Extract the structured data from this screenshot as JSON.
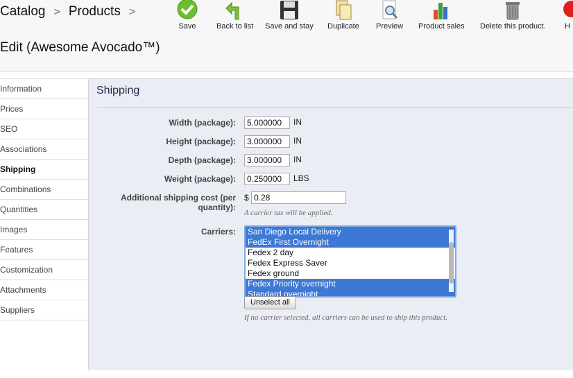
{
  "breadcrumb": {
    "catalog": "Catalog",
    "sep": ">",
    "products": "Products"
  },
  "page_title": "Edit (Awesome Avocado™)",
  "toolbar": {
    "save": "Save",
    "back": "Back to list",
    "save_stay": "Save and stay",
    "duplicate": "Duplicate",
    "preview": "Preview",
    "sales": "Product sales",
    "delete": "Delete this product.",
    "help": "H"
  },
  "sidebar": {
    "items": [
      {
        "label": "Information"
      },
      {
        "label": "Prices"
      },
      {
        "label": "SEO"
      },
      {
        "label": "Associations"
      },
      {
        "label": "Shipping"
      },
      {
        "label": "Combinations"
      },
      {
        "label": "Quantities"
      },
      {
        "label": "Images"
      },
      {
        "label": "Features"
      },
      {
        "label": "Customization"
      },
      {
        "label": "Attachments"
      },
      {
        "label": "Suppliers"
      }
    ],
    "active": "Shipping"
  },
  "shipping": {
    "title": "Shipping",
    "width": {
      "label": "Width (package):",
      "value": "5.000000",
      "unit": "IN"
    },
    "height": {
      "label": "Height (package):",
      "value": "3.000000",
      "unit": "IN"
    },
    "depth": {
      "label": "Depth (package):",
      "value": "3.000000",
      "unit": "IN"
    },
    "weight": {
      "label": "Weight (package):",
      "value": "0.250000",
      "unit": "LBS"
    },
    "additional_cost": {
      "label_line1": "Additional shipping cost (per",
      "label_line2": "quantity):",
      "currency": "$",
      "value": "0.28",
      "hint": "A carrier tax will be applied."
    },
    "carriers": {
      "label": "Carriers:",
      "options": [
        {
          "name": "San Diego Local Delivery",
          "selected": true
        },
        {
          "name": "FedEx First Overnight",
          "selected": true
        },
        {
          "name": "Fedex 2 day",
          "selected": false
        },
        {
          "name": "Fedex Express Saver",
          "selected": false
        },
        {
          "name": "Fedex ground",
          "selected": false
        },
        {
          "name": "Fedex Priority overnight",
          "selected": true
        },
        {
          "name": "Standard overnight",
          "selected": true
        }
      ],
      "unselect_all": "Unselect all",
      "hint": "If no carrier selected, all carriers can be used to ship this product."
    }
  },
  "colors": {
    "selection": "#3d79d4",
    "panel_bg": "#ebedf4"
  }
}
